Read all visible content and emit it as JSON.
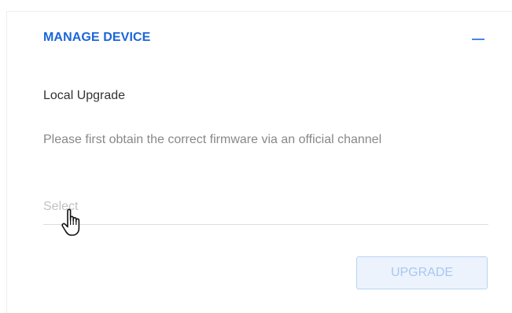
{
  "panel": {
    "title": "MANAGE DEVICE",
    "collapse_icon": "minus-icon"
  },
  "local_upgrade": {
    "label": "Local Upgrade",
    "description": "Please first obtain the correct firmware via an official channel",
    "select_placeholder": "Select",
    "upgrade_button_label": "UPGRADE",
    "upgrade_button_state": "disabled"
  },
  "cursor": {
    "icon": "hand-pointer-icon"
  },
  "colors": {
    "accent": "#1a66d9",
    "button_disabled_text": "#a9c7ef",
    "button_disabled_bg": "#ecf3fd"
  }
}
